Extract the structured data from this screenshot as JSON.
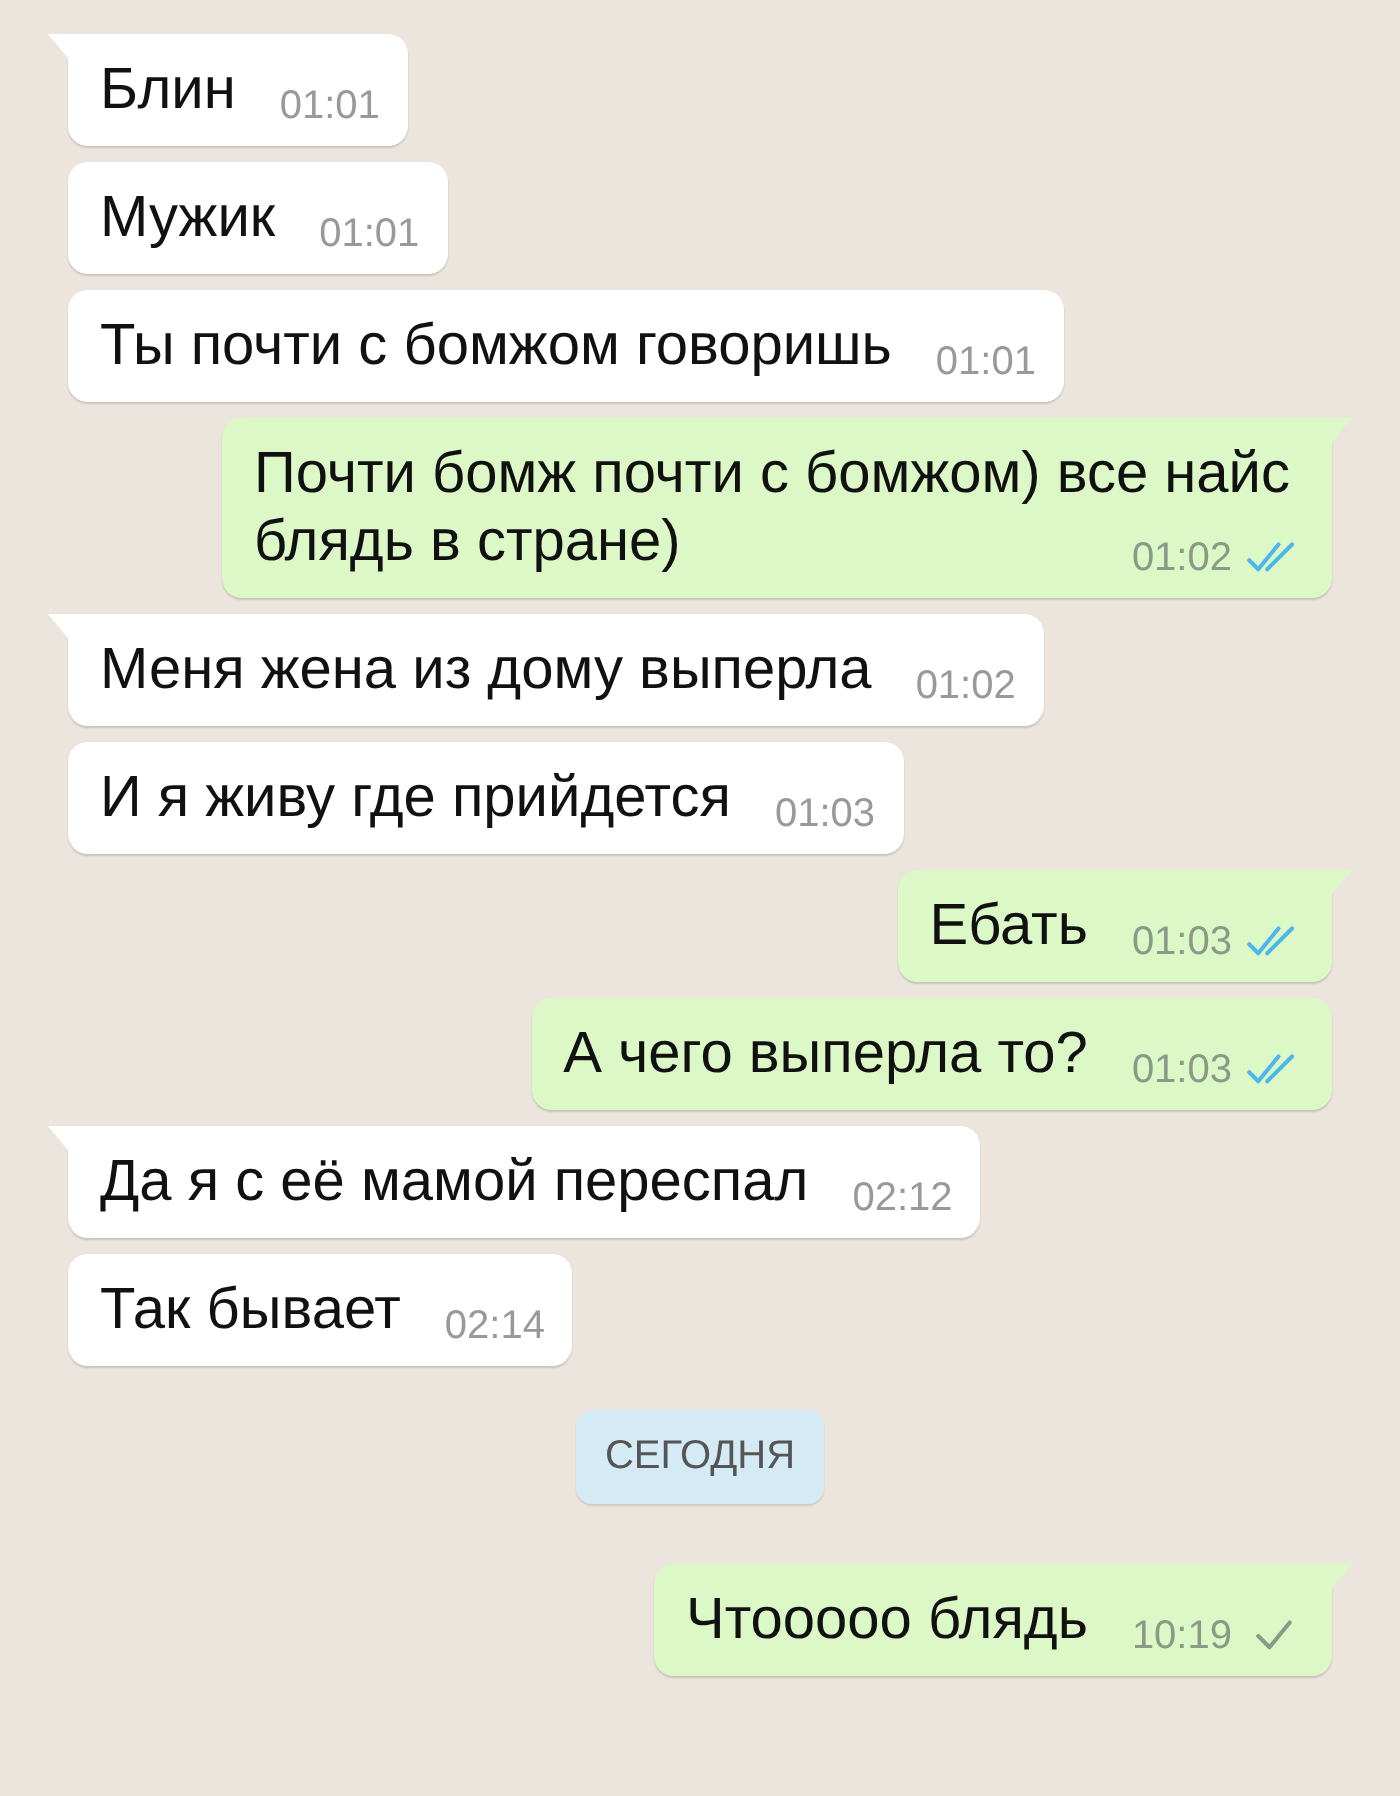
{
  "messages": [
    {
      "kind": "message",
      "outgoing": false,
      "text": "Блин",
      "time": "01:01"
    },
    {
      "kind": "message",
      "outgoing": false,
      "text": "Мужик",
      "time": "01:01"
    },
    {
      "kind": "message",
      "outgoing": false,
      "text": "Ты почти с бомжом говоришь",
      "time": "01:01"
    },
    {
      "kind": "message",
      "outgoing": true,
      "text": "Почти бомж почти с бомжом) все найс блядь в стране)",
      "time": "01:02",
      "read": true
    },
    {
      "kind": "message",
      "outgoing": false,
      "text": "Меня жена из дому выперла",
      "time": "01:02"
    },
    {
      "kind": "message",
      "outgoing": false,
      "text": "И я живу где прийдется",
      "time": "01:03"
    },
    {
      "kind": "message",
      "outgoing": true,
      "text": "Ебать",
      "time": "01:03",
      "read": true
    },
    {
      "kind": "message",
      "outgoing": true,
      "text": "А чего выперла то?",
      "time": "01:03",
      "read": true
    },
    {
      "kind": "message",
      "outgoing": false,
      "text": "Да я с её мамой переспал",
      "time": "02:12"
    },
    {
      "kind": "message",
      "outgoing": false,
      "text": "Так бывает",
      "time": "02:14"
    },
    {
      "kind": "date",
      "text": "СЕГОДНЯ"
    },
    {
      "kind": "message",
      "outgoing": true,
      "text": "Чтооооо блядь",
      "time": "10:19",
      "read": false
    }
  ]
}
